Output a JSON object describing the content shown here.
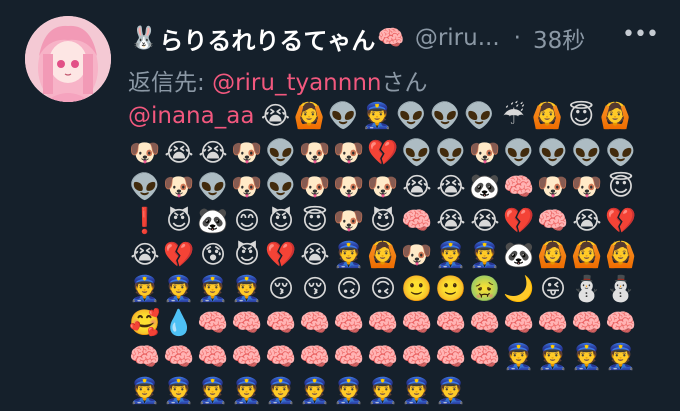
{
  "tweet": {
    "display_name": "らりるれりるてゃん",
    "name_emoji_left": "🐰",
    "name_emoji_right": "🧠",
    "handle": "@riru...",
    "separator": "·",
    "time": "38秒",
    "more": "•••",
    "reply_prefix": "返信先:",
    "reply_to": "@riru_tyannnn",
    "reply_suffix": "さん",
    "mention": "@inana_aa",
    "line1_emojis": [
      "😭",
      "🙆",
      "👽",
      "👮",
      "👽",
      "👽",
      "👽",
      "☔",
      "🙆",
      "😇",
      "🙆"
    ],
    "rows": [
      [
        "🐶",
        "😭",
        "😭",
        "🐶",
        "👽",
        "🐶",
        "🐶",
        "💔",
        "👽",
        "👽",
        "🐶",
        "👽",
        "👽",
        "👽",
        "👽"
      ],
      [
        "👽",
        "🐶",
        "👽",
        "🐶",
        "👽",
        "🐶",
        "🐶",
        "🐶",
        "😭",
        "😭",
        "🐼",
        "🧠",
        "🐶",
        "🐶",
        "😇"
      ],
      [
        "❗",
        "😈",
        "🐼",
        "😊",
        "😈",
        "😇",
        "🐶",
        "😈",
        "🧠",
        "😭",
        "😭",
        "💔",
        "🧠",
        "😭",
        "💔"
      ],
      [
        "😭",
        "💔",
        "😰",
        "😈",
        "💔",
        "😭",
        "👮",
        "🙆",
        "🐶",
        "👮",
        "👮",
        "🐼",
        "🙆",
        "🙆",
        "🙆"
      ],
      [
        "👮",
        "👮",
        "👮",
        "👮",
        "😚",
        "😚",
        "🙃",
        "🙃",
        "🙂",
        "🙂",
        "🤢",
        "🌙",
        "😜",
        "⛄",
        "⛄"
      ],
      [
        "🥰",
        "💧",
        "🧠",
        "🧠",
        "🧠",
        "🧠",
        "🧠",
        "🧠",
        "🧠",
        "🧠",
        "🧠",
        "🧠",
        "🧠",
        "🧠",
        "🧠"
      ],
      [
        "🧠",
        "🧠",
        "🧠",
        "🧠",
        "🧠",
        "🧠",
        "🧠",
        "🧠",
        "🧠",
        "🧠",
        "🧠",
        "👮",
        "👮",
        "👮",
        "👮"
      ],
      [
        "👮",
        "👮",
        "👮",
        "👮",
        "👮",
        "👮",
        "👮",
        "👮",
        "👮",
        "👮"
      ]
    ]
  },
  "colors": {
    "background": "#15202b",
    "accent": "#f2587e",
    "muted": "#8b98a5"
  }
}
